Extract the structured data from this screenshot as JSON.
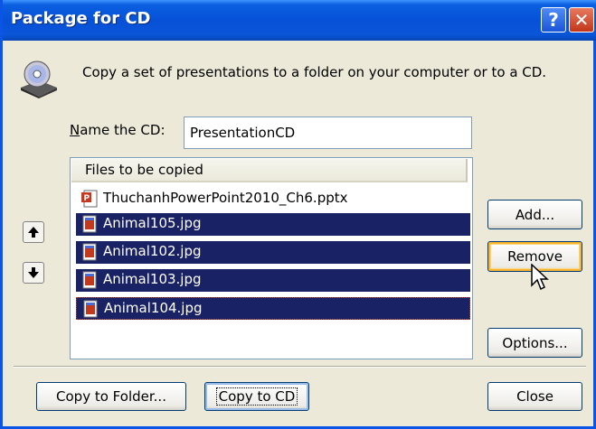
{
  "title": "Package for CD",
  "titlebar": {
    "help_glyph": "?",
    "close_glyph": "✕"
  },
  "intro_text": "Copy a set of presentations to a folder on your computer or to a CD.",
  "name_cd": {
    "label": "Name the CD:",
    "value": "PresentationCD"
  },
  "files": {
    "header": "Files to be copied",
    "items": [
      {
        "name": "ThuchanhPowerPoint2010_Ch6.pptx",
        "icon": "pptx-file-icon",
        "selected": false
      },
      {
        "name": "Animal105.jpg",
        "icon": "jpg-file-icon",
        "selected": true
      },
      {
        "name": "Animal102.jpg",
        "icon": "jpg-file-icon",
        "selected": true
      },
      {
        "name": "Animal103.jpg",
        "icon": "jpg-file-icon",
        "selected": true
      },
      {
        "name": "Animal104.jpg",
        "icon": "jpg-file-icon",
        "selected": true
      }
    ]
  },
  "buttons": {
    "add": "Add...",
    "remove": "Remove",
    "options": "Options...",
    "copy_to_folder": "Copy to Folder...",
    "copy_to_cd": "Copy to CD",
    "close": "Close"
  },
  "colors": {
    "titlebar": "#0a55d8",
    "selection": "#1a2266",
    "dialog_bg": "#ece9d8"
  }
}
